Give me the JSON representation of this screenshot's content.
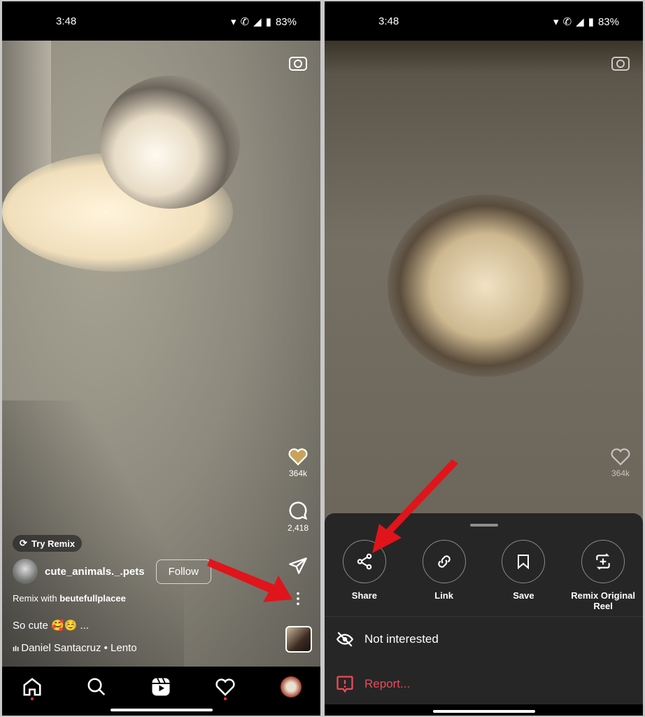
{
  "status": {
    "time": "3:48",
    "battery": "83%"
  },
  "left": {
    "likes": "364k",
    "comments": "2,418",
    "try_remix": "Try Remix",
    "username": "cute_animals._.pets",
    "follow": "Follow",
    "remix_prefix": "Remix with ",
    "remix_user": "beutefullplacee",
    "caption": "So cute 🥰☺️ ...",
    "audio": "Daniel Santacruz • Lento",
    "nav": [
      "home-icon",
      "search-icon",
      "reels-icon",
      "heart-icon",
      "profile-avatar"
    ]
  },
  "right": {
    "likes": "364k",
    "actions": [
      {
        "label": "Share",
        "icon": "share-icon"
      },
      {
        "label": "Link",
        "icon": "link-icon"
      },
      {
        "label": "Save",
        "icon": "bookmark-icon"
      },
      {
        "label": "Remix Original Reel",
        "icon": "remix-icon"
      }
    ],
    "not_interested": "Not interested",
    "report": "Report..."
  },
  "colors": {
    "sheet": "#262626",
    "report": "#ed4956",
    "annotation_arrow": "#e0141b"
  }
}
